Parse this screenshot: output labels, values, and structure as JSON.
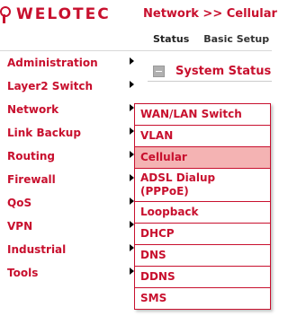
{
  "brand": {
    "name": "WELOTEC",
    "logo_icon": "welotec-logo-icon",
    "accent_color": "#c8102e"
  },
  "header": {
    "title": "Network >> Cellular"
  },
  "tabs": [
    {
      "label": "Status",
      "active": true
    },
    {
      "label": "Basic Setup",
      "active": false
    }
  ],
  "sidebar": {
    "items": [
      {
        "label": "Administration",
        "has_submenu": true
      },
      {
        "label": "Layer2 Switch",
        "has_submenu": true
      },
      {
        "label": "Network",
        "has_submenu": true
      },
      {
        "label": "Link Backup",
        "has_submenu": true
      },
      {
        "label": "Routing",
        "has_submenu": true
      },
      {
        "label": "Firewall",
        "has_submenu": true
      },
      {
        "label": "QoS",
        "has_submenu": true
      },
      {
        "label": "VPN",
        "has_submenu": true
      },
      {
        "label": "Industrial",
        "has_submenu": true
      },
      {
        "label": "Tools",
        "has_submenu": true
      }
    ]
  },
  "status_panel": {
    "title": "System Status",
    "collapse_icon": "minus-icon"
  },
  "submenu": {
    "items": [
      {
        "label": "WAN/LAN Switch"
      },
      {
        "label": "VLAN"
      },
      {
        "label": "Cellular",
        "active": true
      },
      {
        "label": "ADSL Dialup (PPPoE)"
      },
      {
        "label": "Loopback"
      },
      {
        "label": "DHCP"
      },
      {
        "label": "DNS"
      },
      {
        "label": "DDNS"
      },
      {
        "label": "SMS"
      }
    ]
  }
}
